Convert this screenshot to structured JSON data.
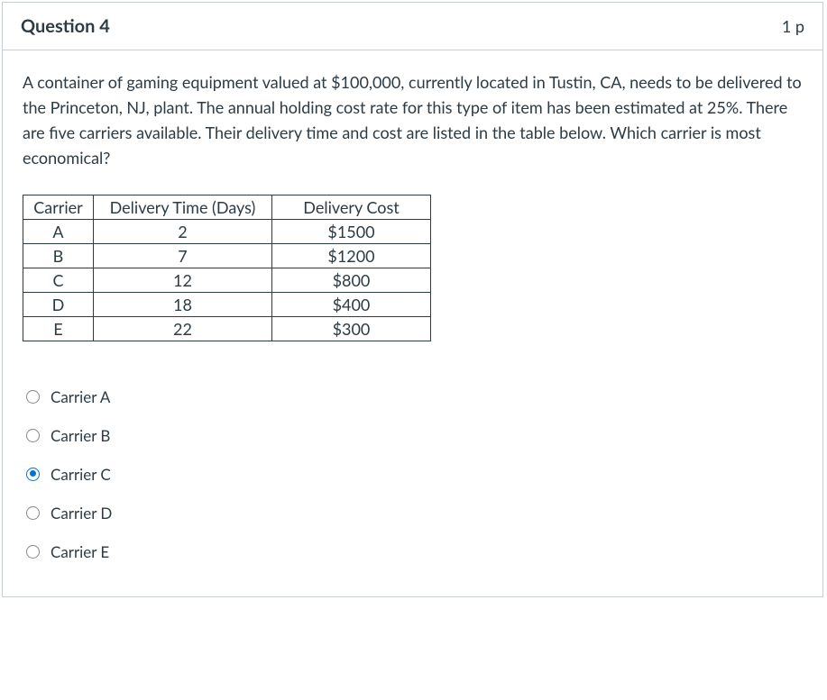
{
  "header": {
    "title": "Question 4",
    "points": "1 p"
  },
  "prompt": "A container of gaming equipment valued at $100,000, currently located in Tustin, CA, needs to be delivered to the Princeton, NJ, plant. The annual holding cost rate for this type of item has been estimated at 25%. There are five carriers available. Their delivery time and cost are listed in the table below. Which carrier is most economical?",
  "table": {
    "headers": [
      "Carrier",
      "Delivery Time (Days)",
      "Delivery Cost"
    ],
    "rows": [
      {
        "carrier": "A",
        "time": "2",
        "cost": "$1500"
      },
      {
        "carrier": "B",
        "time": "7",
        "cost": "$1200"
      },
      {
        "carrier": "C",
        "time": "12",
        "cost": "$800"
      },
      {
        "carrier": "D",
        "time": "18",
        "cost": "$400"
      },
      {
        "carrier": "E",
        "time": "22",
        "cost": "$300"
      }
    ]
  },
  "options": [
    {
      "label": "Carrier A",
      "selected": false
    },
    {
      "label": "Carrier B",
      "selected": false
    },
    {
      "label": "Carrier C",
      "selected": true
    },
    {
      "label": "Carrier D",
      "selected": false
    },
    {
      "label": "Carrier E",
      "selected": false
    }
  ]
}
